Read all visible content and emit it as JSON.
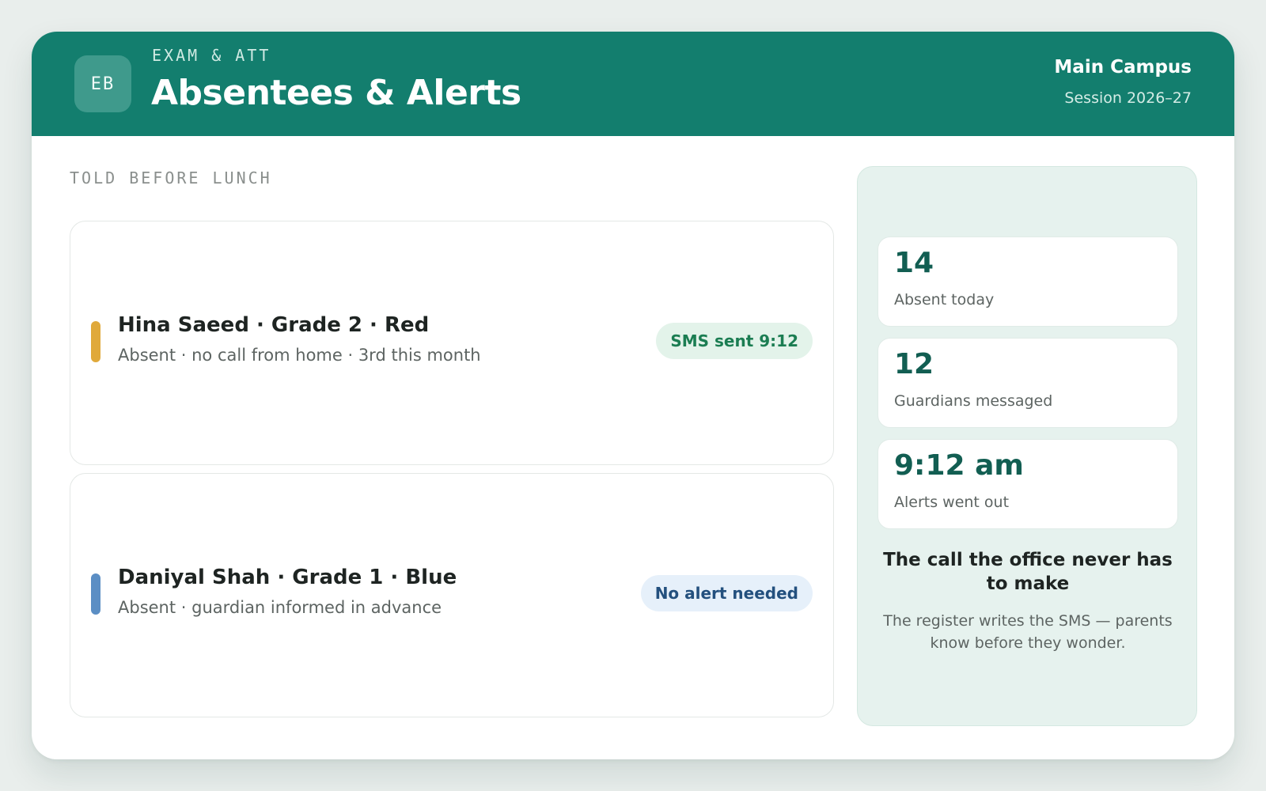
{
  "header": {
    "logo_initials": "EB",
    "eyebrow": "EXAM & ATT",
    "title": "Absentees & Alerts",
    "campus": "Main Campus",
    "session": "Session 2026–27"
  },
  "main": {
    "section_label": "TOLD BEFORE LUNCH",
    "alerts": [
      {
        "name": "Hina Saeed · Grade 2 · Red",
        "detail": "Absent · no call from home · 3rd this month",
        "status": "SMS sent 9:12",
        "bar_color": "#e0a93a",
        "pill_bg": "#e3f3ea",
        "pill_color": "#1b7d52"
      },
      {
        "name": "Daniyal Shah · Grade 1 · Blue",
        "detail": "Absent · guardian informed in advance",
        "status": "No alert needed",
        "bar_color": "#5b8ec4",
        "pill_bg": "#e6f0fa",
        "pill_color": "#23507e"
      }
    ]
  },
  "sidebar": {
    "stats": [
      {
        "value": "14",
        "label": "Absent today"
      },
      {
        "value": "12",
        "label": "Guardians messaged"
      },
      {
        "value": "9:12 am",
        "label": "Alerts went out"
      }
    ],
    "title": "The call the office never has to make",
    "text": "The register writes the SMS — parents know before they wonder."
  },
  "colors": {
    "accent": "#137e6e",
    "stat_number": "#125e52",
    "sidebar_bg": "#e6f2ee"
  }
}
